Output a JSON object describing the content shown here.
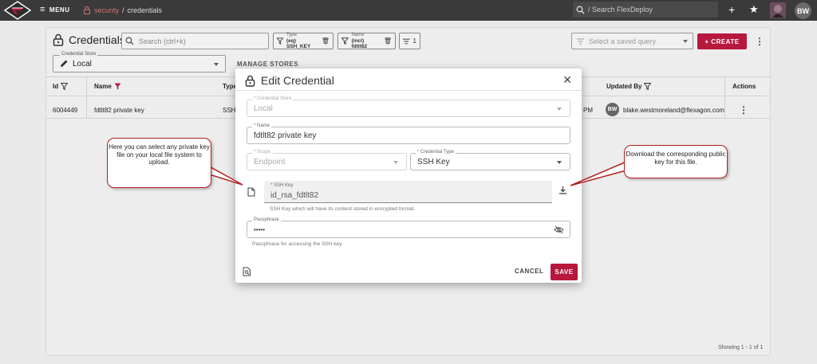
{
  "topbar": {
    "menu_label": "MENU",
    "breadcrumb_root": "security",
    "breadcrumb_sep": "/",
    "breadcrumb_current": "credentials",
    "search_placeholder": "/ Search FlexDeploy",
    "avatar_initials": "BW"
  },
  "page": {
    "title": "Credentials",
    "search_placeholder": "Search (ctrl+k)",
    "filters": [
      {
        "label": "Type",
        "value": "(eq) SSH_KEY"
      },
      {
        "label": "Name",
        "value": "(incl) fdtlt82"
      }
    ],
    "filter_count": "1",
    "saved_query_placeholder": "Select a saved query",
    "create_label": "+ CREATE",
    "store_label": "Credential Store",
    "store_value": "Local",
    "manage_stores": "MANAGE STORES",
    "showing": "Showing 1 - 1 of 1"
  },
  "table": {
    "headers": {
      "id": "Id",
      "name": "Name",
      "type": "Type",
      "updated_by": "Updated By",
      "actions": "Actions"
    },
    "rows": [
      {
        "id": "6004449",
        "name": "fdtlt82 private key",
        "type": "SSH",
        "time_fragment": "PM",
        "avatar": "BW",
        "updated_by": "blake.westmoreland@flexagon.com"
      }
    ]
  },
  "modal": {
    "title": "Edit Credential",
    "store_label": "* Credential Store",
    "store_value": "Local",
    "name_label": "* Name",
    "name_value": "fdtlt82 private key",
    "scope_label": "* Scope",
    "scope_value": "Endpoint",
    "type_label": "* Credential Type",
    "type_value": "SSH Key",
    "ssh_label": "* SSH Key",
    "ssh_value": "id_rsa_fdtlt82",
    "ssh_helper": "SSH Key which will have its content stored in encrypted format.",
    "pass_label": "Passphrase",
    "pass_value": "•••••",
    "pass_helper": "Passphrase for accessing the SSH key.",
    "cancel_label": "CANCEL",
    "save_label": "SAVE"
  },
  "callouts": {
    "left": "Here you can select any private key file on your local file system to upload.",
    "right": "Download the corresponding public key for this file."
  },
  "colors": {
    "accent": "#b8173e",
    "topbar": "#3a3a3a",
    "callout_border": "#b32020"
  }
}
